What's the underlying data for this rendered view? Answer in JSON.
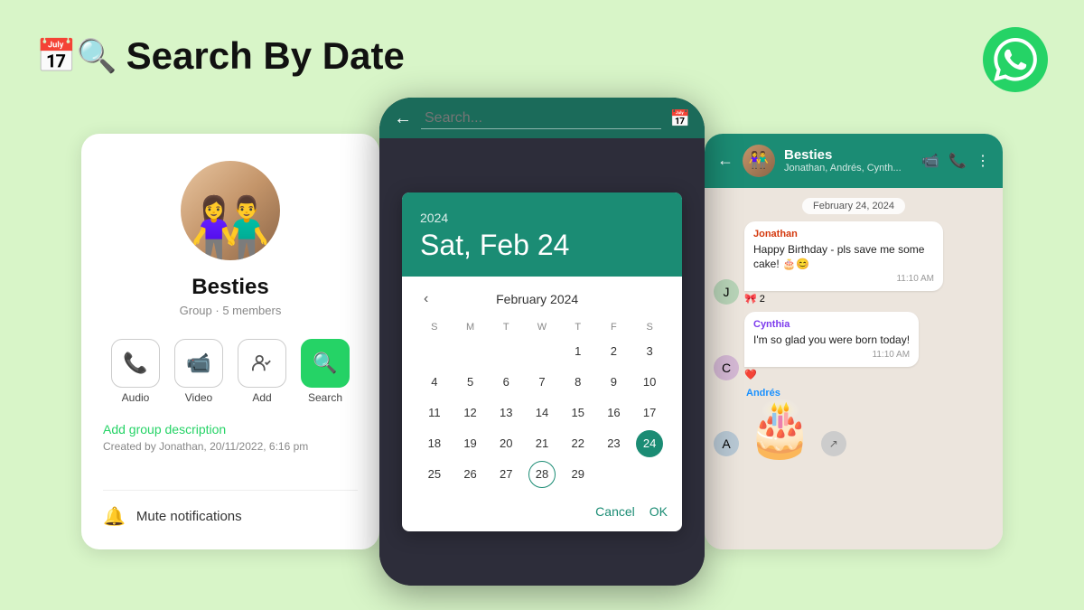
{
  "header": {
    "title": "Search By Date",
    "title_icon": "📅"
  },
  "left_panel": {
    "contact_name": "Besties",
    "contact_subtitle": "Group · 5 members",
    "actions": [
      {
        "label": "Audio",
        "icon": "📞",
        "active": false
      },
      {
        "label": "Video",
        "icon": "📹",
        "active": false
      },
      {
        "label": "Add",
        "icon": "👤+",
        "active": false
      },
      {
        "label": "Search",
        "icon": "🔍",
        "active": true
      }
    ],
    "group_desc_link": "Add group description",
    "group_created": "Created by Jonathan, 20/11/2022, 6:16 pm",
    "mute_label": "Mute notifications"
  },
  "center_panel": {
    "search_placeholder": "Search...",
    "calendar": {
      "year": "2024",
      "date_display": "Sat, Feb 24",
      "month_label": "February 2024",
      "days_of_week": [
        "S",
        "M",
        "T",
        "W",
        "T",
        "F",
        "S"
      ],
      "weeks": [
        [
          "",
          "",
          "",
          "",
          "1",
          "2",
          "3"
        ],
        [
          "4",
          "5",
          "6",
          "7",
          "8",
          "9",
          "10"
        ],
        [
          "11",
          "12",
          "13",
          "14",
          "15",
          "16",
          "17"
        ],
        [
          "18",
          "19",
          "20",
          "21",
          "22",
          "23",
          "24"
        ],
        [
          "25",
          "26",
          "27",
          "28",
          "29",
          "",
          ""
        ]
      ],
      "selected_day": "24",
      "today_day": "28",
      "cancel_label": "Cancel",
      "ok_label": "OK"
    }
  },
  "right_panel": {
    "chat_name": "Besties",
    "chat_members": "Jonathan, Andrés, Cynth...",
    "date_divider": "February 24, 2024",
    "messages": [
      {
        "sender": "Jonathan",
        "sender_class": "jonathan",
        "text": "Happy Birthday - pls save me some cake! 🎂😊",
        "time": "11:10 AM",
        "reactions": "🎀 2"
      },
      {
        "sender": "Cynthia",
        "sender_class": "cynthia",
        "text": "I'm so glad you were born today!",
        "time": "11:10 AM",
        "reactions": "❤️"
      },
      {
        "sender": "Andrés",
        "sender_class": "andres",
        "sticker": "🎂"
      }
    ]
  }
}
